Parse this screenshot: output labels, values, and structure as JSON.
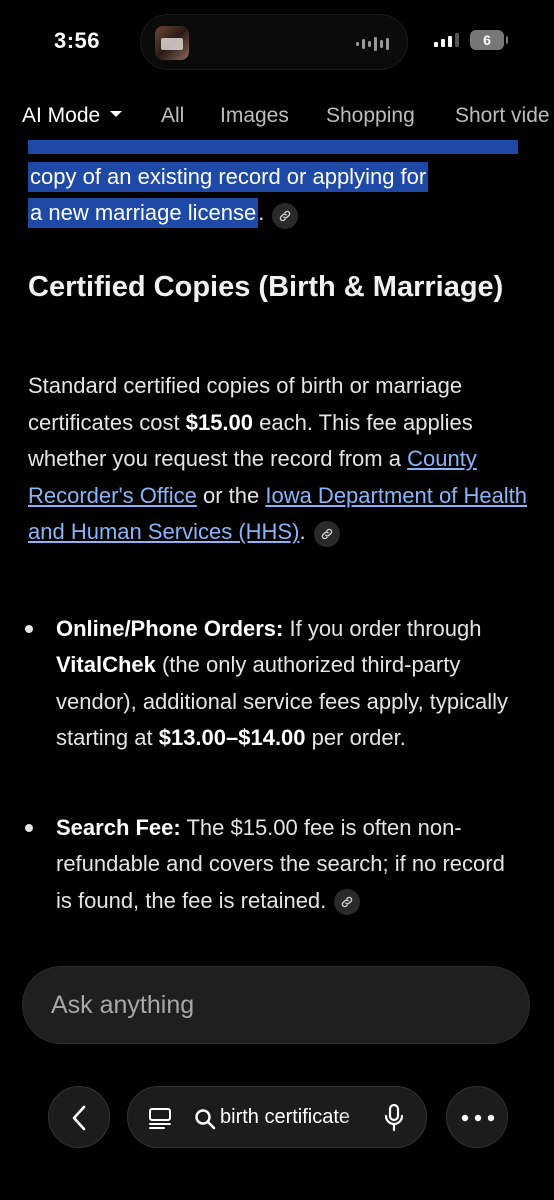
{
  "status": {
    "time": "3:56",
    "battery": "6"
  },
  "tabs": [
    {
      "label": "AI Mode"
    },
    {
      "label": "All"
    },
    {
      "label": "Images"
    },
    {
      "label": "Shopping"
    },
    {
      "label": "Short vide"
    }
  ],
  "highlight": {
    "line1": "copy of an existing record or applying for",
    "line2": "a new marriage license",
    "after": "."
  },
  "section": {
    "title": "Certified Copies (Birth & Marriage)",
    "para": {
      "t1": "Standard certified copies of birth or marriage certificates cost ",
      "bold1": "$15.00",
      "t2": " each. This fee applies whether you request the record from a ",
      "link1": "County Recorder's Office",
      "t3": " or the ",
      "link2": "Iowa Department of Health and Human Services (HHS)",
      "t4": "."
    },
    "bullets": [
      {
        "bold": "Online/Phone Orders:",
        "t1": " If you order through ",
        "bold2": "VitalChek",
        "t2": " (the only authorized third-party vendor), additional service fees apply, typically starting at ",
        "bold3": "$13.00–$14.00",
        "t3": " per order."
      },
      {
        "bold": "Search Fee:",
        "t1": " The $15.00 fee is often non-refundable and covers the search; if no record is found, the fee is retained."
      }
    ]
  },
  "ask": {
    "placeholder": "Ask anything"
  },
  "bottom": {
    "query": "birth certificate"
  },
  "icons": {
    "link": "link-icon",
    "back": "chevron-left-icon",
    "menu": "list-icon",
    "search": "search-icon",
    "mic": "mic-icon",
    "more": "more-horizontal-icon"
  },
  "colors": {
    "highlight": "#1e49a6",
    "link": "#8ab4f8",
    "background": "#000000"
  }
}
